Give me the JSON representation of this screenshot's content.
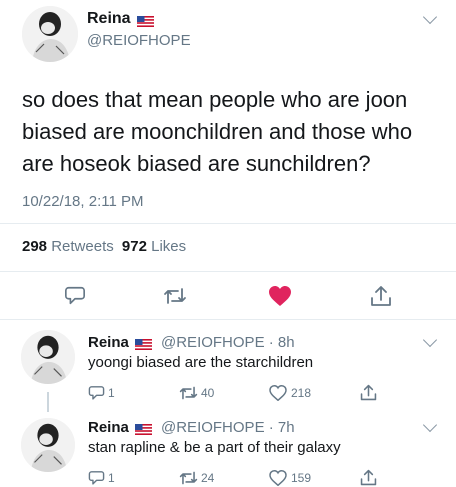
{
  "main_tweet": {
    "name": "Reina",
    "handle": "@REIOFHOPE",
    "text_lines": [
      "so does that mean people who are joon",
      "biased are moonchildren and those who",
      "are hoseok biased are sunchildren?"
    ],
    "timestamp": "10/22/18, 2:11 PM",
    "retweets_count": "298",
    "retweets_label": "Retweets",
    "likes_count": "972",
    "likes_label": "Likes",
    "liked": true
  },
  "replies": [
    {
      "name": "Reina",
      "handle_time": "@REIOFHOPE · 8h",
      "text": "yoongi biased are the starchildren",
      "reply_count": "1",
      "retweet_count": "40",
      "like_count": "218"
    },
    {
      "name": "Reina",
      "handle_time": "@REIOFHOPE · 7h",
      "text": "stan rapline & be a part of their galaxy",
      "reply_count": "1",
      "retweet_count": "24",
      "like_count": "159"
    }
  ],
  "colors": {
    "text": "#14171a",
    "secondary": "#657786",
    "like_red": "#e0245e",
    "divider": "#e6ecf0",
    "icon_gray": "#657786"
  },
  "icons": [
    "avatar",
    "us-flag-icon",
    "chevron-down-icon",
    "reply-icon",
    "retweet-icon",
    "heart-icon",
    "share-icon"
  ]
}
